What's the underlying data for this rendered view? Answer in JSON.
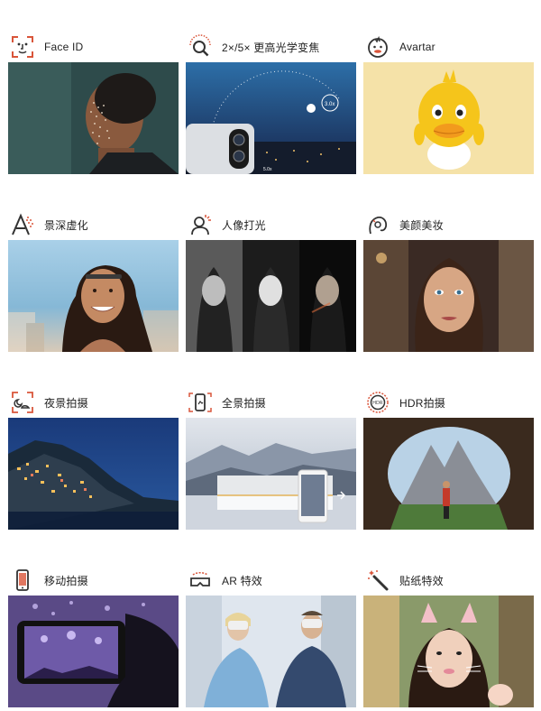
{
  "features": [
    {
      "label": "Face ID",
      "icon": "face-id-icon"
    },
    {
      "label": "2×/5× 更高光学变焦",
      "icon": "zoom-magnifier-icon"
    },
    {
      "label": "Avartar",
      "icon": "duck-avatar-icon"
    },
    {
      "label": "景深虚化",
      "icon": "depth-blur-icon"
    },
    {
      "label": "人像打光",
      "icon": "portrait-lighting-icon"
    },
    {
      "label": "美颜美妆",
      "icon": "beauty-makeup-icon"
    },
    {
      "label": "夜景拍摄",
      "icon": "night-scene-icon"
    },
    {
      "label": "全景拍摄",
      "icon": "panorama-icon"
    },
    {
      "label": "HDR拍摄",
      "icon": "hdr-icon"
    },
    {
      "label": "移动拍摄",
      "icon": "mobile-shooting-icon"
    },
    {
      "label": "AR 特效",
      "icon": "vr-headset-icon"
    },
    {
      "label": "贴纸特效",
      "icon": "magic-wand-icon"
    }
  ],
  "zoom_readouts": [
    "3.0x",
    "5.0x"
  ],
  "colors": {
    "icon_accent": "#d9553a",
    "icon_stroke": "#333333"
  }
}
